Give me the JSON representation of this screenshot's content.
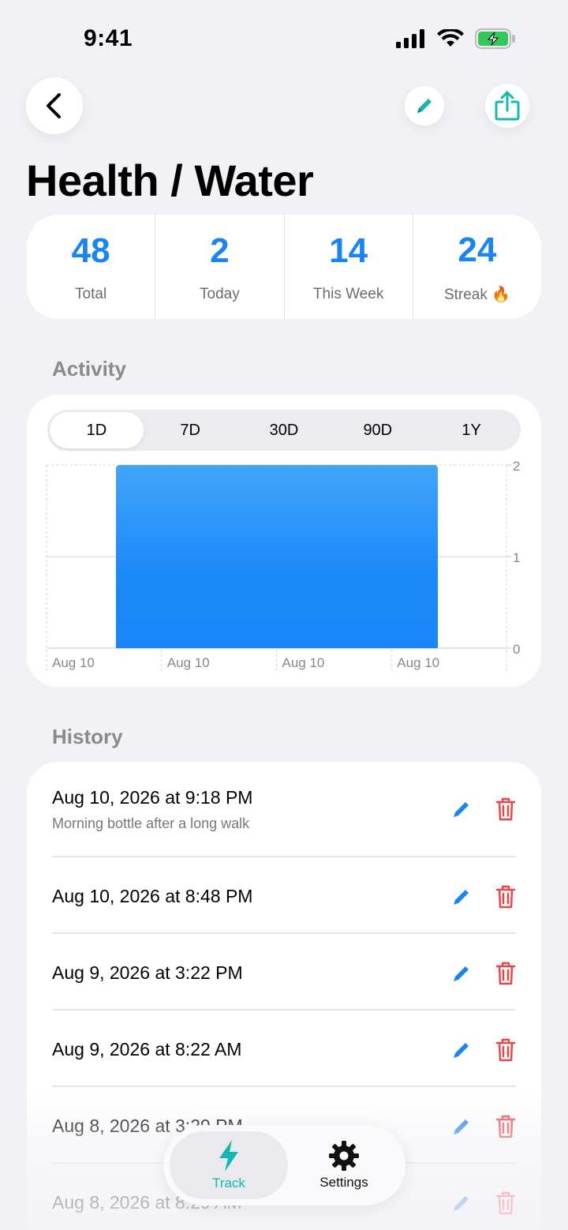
{
  "status_bar": {
    "time": "9:41"
  },
  "header": {
    "title": "Health / Water"
  },
  "stats": [
    {
      "value": "48",
      "label": "Total"
    },
    {
      "value": "2",
      "label": "Today"
    },
    {
      "value": "14",
      "label": "This Week"
    },
    {
      "value": "24",
      "label": "Streak 🔥"
    }
  ],
  "activity": {
    "section_title": "Activity",
    "ranges": [
      "1D",
      "7D",
      "30D",
      "90D",
      "1Y"
    ],
    "selected_range": "1D"
  },
  "chart_data": {
    "type": "bar",
    "categories": [
      "Aug 10"
    ],
    "values": [
      2
    ],
    "x_tick_labels": [
      "Aug 10",
      "Aug 10",
      "Aug 10",
      "Aug 10"
    ],
    "y_ticks": [
      "0",
      "1",
      "2"
    ],
    "ylim": [
      0,
      2
    ],
    "grid": true,
    "color": "#1a88f8"
  },
  "history": {
    "section_title": "History",
    "entries": [
      {
        "date": "Aug 10, 2026 at 9:18 PM",
        "note": "Morning bottle after a long walk"
      },
      {
        "date": "Aug 10, 2026 at 8:48 PM",
        "note": ""
      },
      {
        "date": "Aug 9, 2026 at 3:22 PM",
        "note": ""
      },
      {
        "date": "Aug 9, 2026 at 8:22 AM",
        "note": ""
      },
      {
        "date": "Aug 8, 2026 at 3:29 PM",
        "note": ""
      },
      {
        "date": "Aug 8, 2026 at 8:29 AM",
        "note": ""
      }
    ]
  },
  "tab_bar": {
    "tabs": [
      {
        "label": "Track",
        "icon": "bolt-icon",
        "active": true
      },
      {
        "label": "Settings",
        "icon": "gear-icon",
        "active": false
      }
    ]
  },
  "colors": {
    "accent": "#1a85f0",
    "teal": "#14b8b0",
    "delete": "#e8474a"
  }
}
